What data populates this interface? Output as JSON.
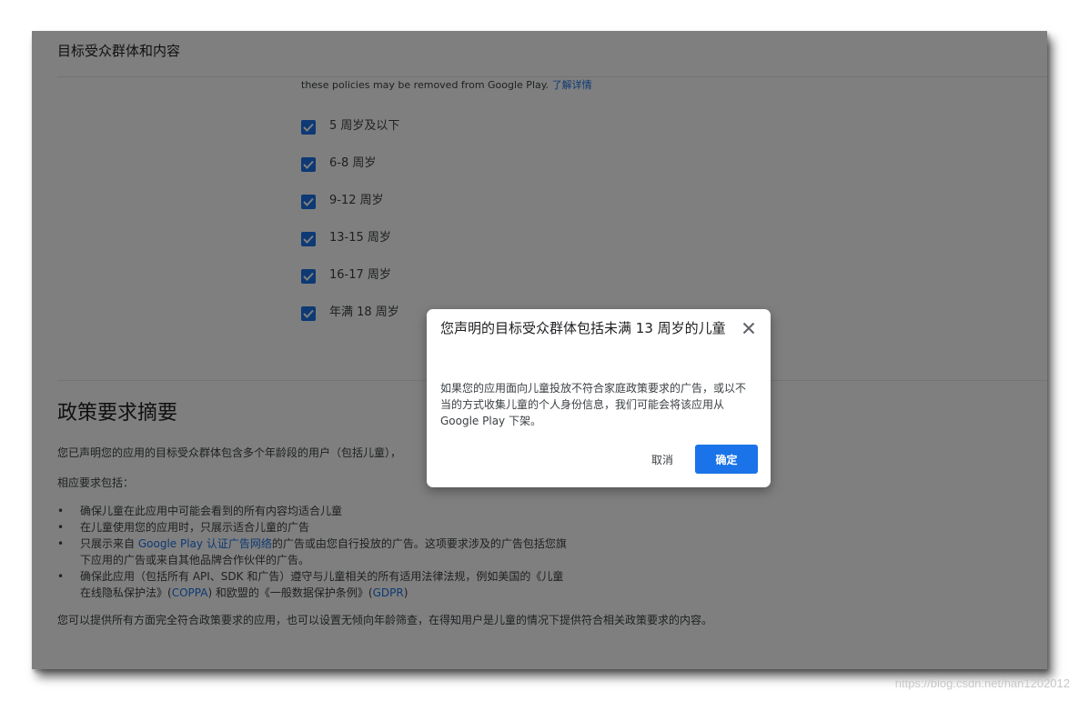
{
  "page": {
    "section_title": "目标受众群体和内容",
    "policy_note": {
      "text": "these policies may be removed from Google Play.",
      "link": "了解详情"
    },
    "age_groups": [
      {
        "label": "5 周岁及以下",
        "checked": true
      },
      {
        "label": "6-8 周岁",
        "checked": true
      },
      {
        "label": "9-12 周岁",
        "checked": true
      },
      {
        "label": "13-15 周岁",
        "checked": true
      },
      {
        "label": "16-17 周岁",
        "checked": true
      },
      {
        "label": "年满 18 周岁",
        "checked": true
      }
    ],
    "summary": {
      "heading": "政策要求摘要",
      "intro": "您已声明您的应用的目标受众群体包含多个年龄段的用户（包括儿童），",
      "requirements_label": "相应要求包括：",
      "requirements": {
        "r1": "确保儿童在此应用中可能会看到的所有内容均适合儿童",
        "r2": "在儿童使用您的应用时，只展示适合儿童的广告",
        "r3_pre": "只展示来自",
        "r3_link": "Google Play 认证广告网络",
        "r3_post": "的广告或由您自行投放的广告。这项要求涉及的广告包括您旗下应用的广告或来自其他品牌合作伙伴的广告。",
        "r4_pre": "确保此应用（包括所有 API、SDK 和广告）遵守与儿童相关的所有适用法律法规，例如美国的《儿童在线隐私保护法》(",
        "r4_link1": "COPPA",
        "r4_mid": ") 和欧盟的《一般数据保护条例》(",
        "r4_link2": "GDPR",
        "r4_post": ")"
      },
      "closing": "您可以提供所有方面完全符合政策要求的应用，也可以设置无倾向年龄筛查，在得知用户是儿童的情况下提供符合相关政策要求的内容。"
    }
  },
  "dialog": {
    "title": "您声明的目标受众群体包括未满 13 周岁的儿童",
    "body": "如果您的应用面向儿童投放不符合家庭政策要求的广告，或以不当的方式收集儿童的个人身份信息，我们可能会将该应用从 Google Play 下架。",
    "cancel_label": "取消",
    "confirm_label": "确定",
    "close_icon": "close-icon"
  },
  "watermark": "https://blog.csdn.net/han1202012",
  "colors": {
    "accent": "#1a73e8",
    "text": "#3c4043",
    "heading": "#202124",
    "scrim": "rgba(0,0,0,0.5)"
  }
}
